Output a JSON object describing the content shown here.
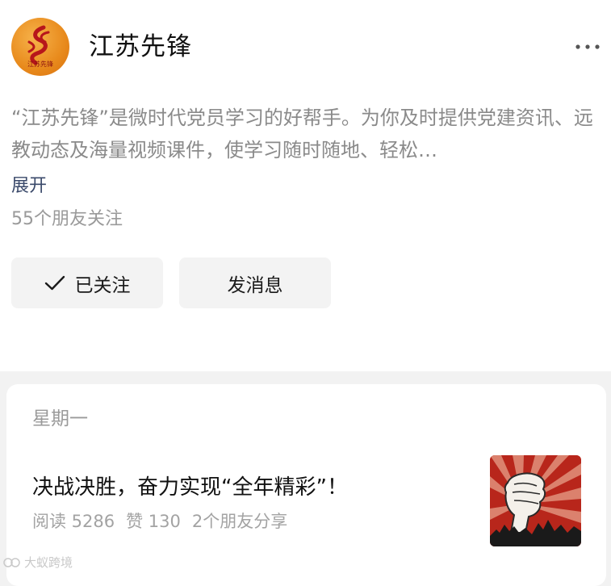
{
  "account": {
    "name": "江苏先锋",
    "avatar_icon": "jiangsu-xianfeng-logo",
    "avatar_text": "江苏先锋",
    "description": "“江苏先锋”是微时代党员学习的好帮手。为你及时提供党建资讯、远教动态及海量视频课件，使学习随时随地、轻松…",
    "expand_label": "展开",
    "followers_text": "55个朋友关注"
  },
  "actions": {
    "followed_label": "已关注",
    "message_label": "发消息"
  },
  "card": {
    "date_label": "星期一",
    "article": {
      "title": "决战决胜，奋力实现“全年精彩”！",
      "reads": "阅读 5286",
      "likes": "赞 130",
      "shares": "2个朋友分享",
      "thumbnail_icon": "raised-fist-poster"
    }
  },
  "watermark": {
    "text": "大蚁跨境"
  },
  "colors": {
    "link": "#3b4a6b",
    "muted": "#8a8a8a",
    "button_bg": "#f3f3f3",
    "page_bg": "#f2f2f2",
    "avatar_orange": "#e88a1c",
    "thumb_red": "#b8261b"
  }
}
